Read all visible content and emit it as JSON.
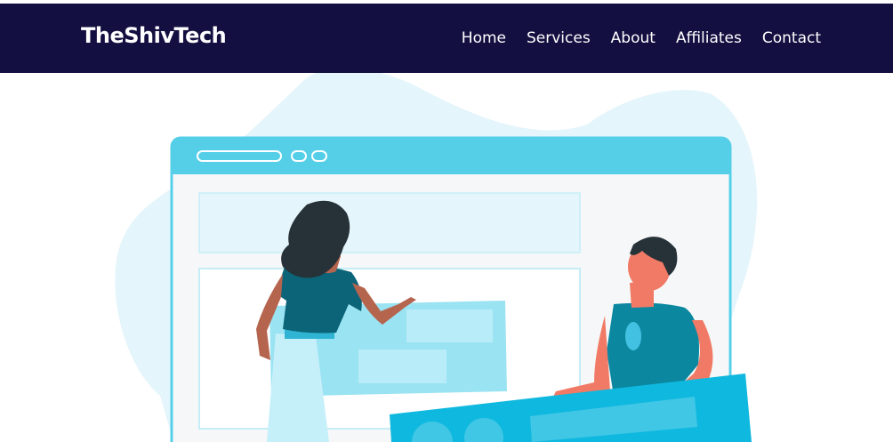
{
  "brand": {
    "name": "TheShivTech"
  },
  "nav": {
    "home": "Home",
    "services": "Services",
    "about": "About",
    "affiliates": "Affiliates",
    "contact": "Contact"
  },
  "hero": {
    "illustration": "web-design-team-illustration"
  },
  "colors": {
    "navbar_bg": "#130f40",
    "nav_text": "#ffffff",
    "blob": "#e4f5fb",
    "browser_bar": "#55cfe8",
    "accent_blue": "#0fb8de"
  }
}
